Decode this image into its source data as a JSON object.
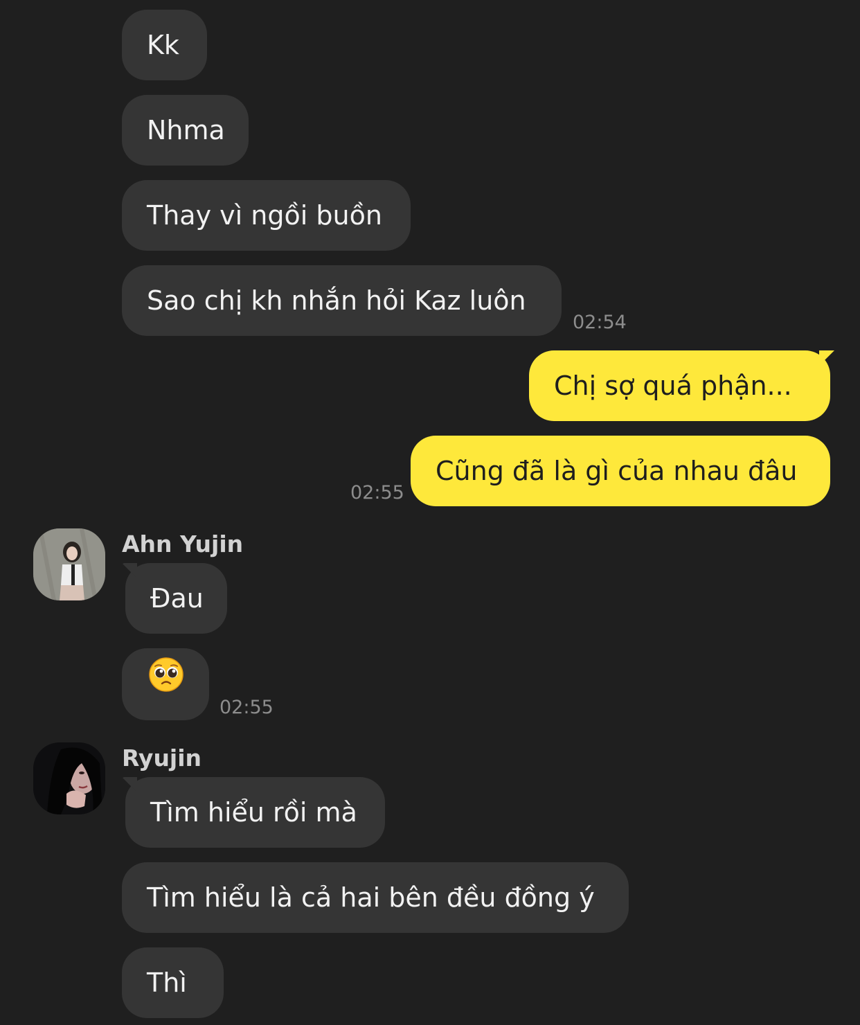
{
  "messages": {
    "m1": "Kk",
    "m2": "Nhma",
    "m3": "Thay vì ngồi buồn",
    "m4": "Sao chị kh nhắn hỏi Kaz luôn",
    "m5": "Chị sợ quá phận...",
    "m6": "Cũng đã là gì của nhau đâu",
    "m7": "Đau",
    "m8_emoji": "pleading-face-emoji",
    "m9": "Tìm hiểu rồi mà",
    "m10": "Tìm hiểu là cả hai bên đều đồng ý",
    "m11": "Thì"
  },
  "times": {
    "t1": "02:54",
    "t2": "02:55",
    "t3": "02:55"
  },
  "senders": {
    "yujin": "Ahn Yujin",
    "ryujin": "Ryujin"
  },
  "colors": {
    "background": "#1f1f1f",
    "incoming_bubble": "#353535",
    "outgoing_bubble": "#fee83b",
    "timestamp": "#8d8d8d"
  }
}
